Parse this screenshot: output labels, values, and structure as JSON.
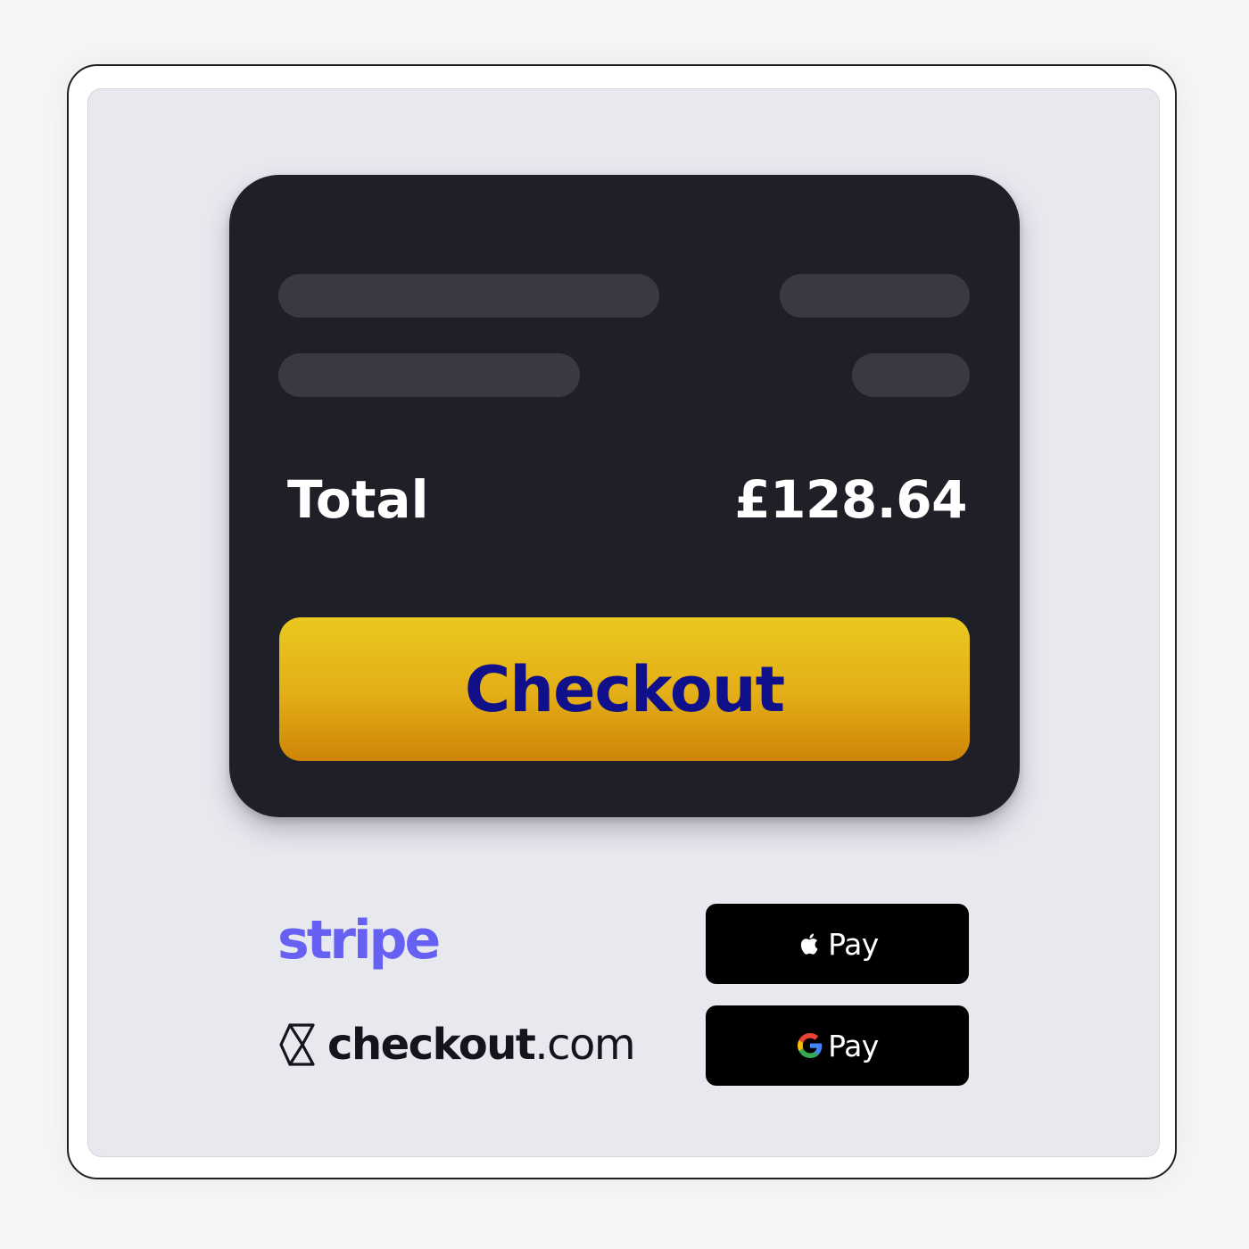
{
  "order_summary": {
    "total_label": "Total",
    "total_value": "£128.64"
  },
  "checkout_button": {
    "label": "Checkout"
  },
  "providers": {
    "stripe": {
      "name": "stripe",
      "color": "#6661f2"
    },
    "checkout_com": {
      "brand": "checkout",
      "suffix": ".com",
      "icon": "checkout-com-hourglass-icon"
    }
  },
  "wallets": {
    "apple_pay": {
      "label": "Pay",
      "icon": "apple-icon"
    },
    "google_pay": {
      "label": "Pay",
      "icon": "google-g-icon"
    }
  },
  "colors": {
    "card_background": "#1f2027",
    "skeleton": "#393a41",
    "button_top": "#e9c81f",
    "button_bottom": "#cd8407",
    "button_text": "#10108a",
    "panel_background": "#e8e8ef"
  }
}
